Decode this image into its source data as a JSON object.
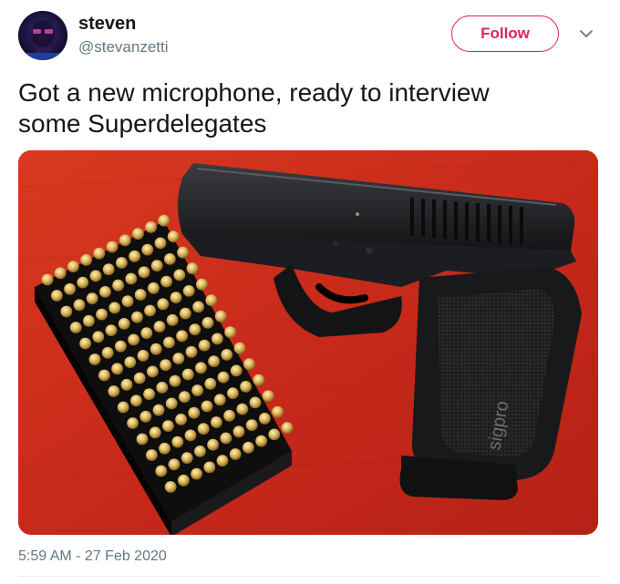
{
  "user": {
    "display_name": "steven",
    "handle": "@stevanzetti"
  },
  "follow_button": {
    "label": "Follow"
  },
  "tweet": {
    "text_line1": "Got a new microphone, ready to interview",
    "text_line2": "some Superdelegates",
    "timestamp": "5:59 AM - 27 Feb 2020"
  },
  "media": {
    "description": "photo",
    "gun_brand_text": "sigpro"
  },
  "colors": {
    "follow_accent": "#e0245e",
    "secondary_text": "#657786",
    "background_red": "#c72a1c"
  },
  "icons": {
    "more": "chevron-down-icon"
  }
}
